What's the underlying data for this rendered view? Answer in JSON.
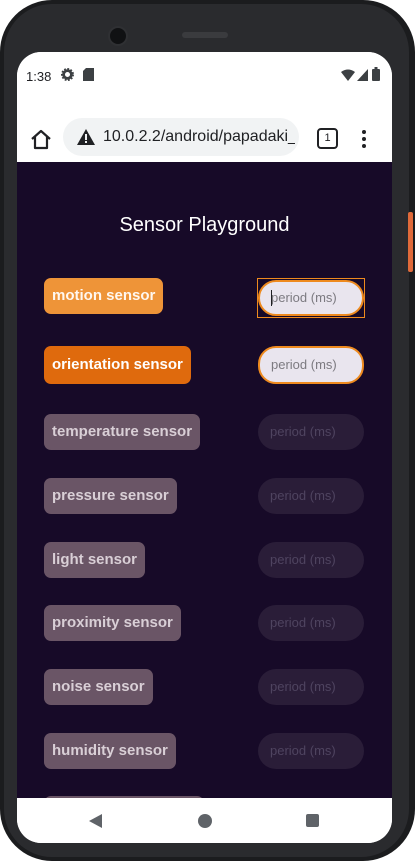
{
  "status_bar": {
    "time": "1:38",
    "icons": [
      "gear-icon",
      "sd-card-icon",
      "wifi-icon",
      "signal-icon",
      "battery-icon"
    ]
  },
  "browser": {
    "url": "10.0.2.2/android/papadaki_",
    "tab_count": "1",
    "icons": [
      "home-icon",
      "warning-icon",
      "tab-switcher-icon",
      "overflow-menu-icon"
    ]
  },
  "page": {
    "title": "Sensor Playground",
    "sensors": [
      {
        "label": "motion sensor",
        "placeholder": "period (ms)",
        "state": "enabled"
      },
      {
        "label": "orientation sensor",
        "placeholder": "period (ms)",
        "state": "enabled"
      },
      {
        "label": "temperature sensor",
        "placeholder": "period (ms)",
        "state": "disabled"
      },
      {
        "label": "pressure sensor",
        "placeholder": "period (ms)",
        "state": "disabled"
      },
      {
        "label": "light sensor",
        "placeholder": "period (ms)",
        "state": "disabled"
      },
      {
        "label": "proximity sensor",
        "placeholder": "period (ms)",
        "state": "disabled"
      },
      {
        "label": "noise sensor",
        "placeholder": "period (ms)",
        "state": "disabled"
      },
      {
        "label": "humidity sensor",
        "placeholder": "period (ms)",
        "state": "disabled"
      }
    ]
  },
  "colors": {
    "page_background": "#170a28",
    "motion_button": "#ee9438",
    "orientation_button": "#df6a0d",
    "disabled_button": "#6a5566",
    "focus_accent": "#ee8a1e"
  },
  "nav_bar": {
    "icons": [
      "back-icon",
      "home-nav-icon",
      "recents-icon"
    ]
  }
}
